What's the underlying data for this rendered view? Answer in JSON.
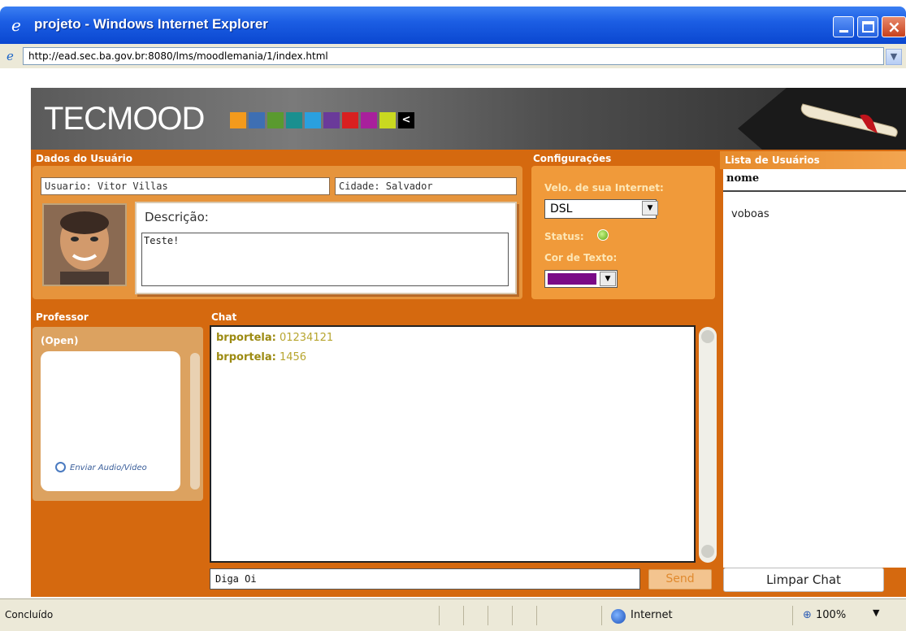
{
  "window": {
    "title": "projeto - Windows Internet Explorer",
    "url": "http://ead.sec.ba.gov.br:8080/lms/moodlemania/1/index.html"
  },
  "app": {
    "logo": "TECMOOD",
    "swatch_colors": [
      "#f39a1c",
      "#3e6fb3",
      "#5a9a2f",
      "#1a8f8f",
      "#2aa0df",
      "#6a3a9a",
      "#d82020",
      "#a8209c",
      "#c9d820"
    ],
    "logo_arrow": "<"
  },
  "user": {
    "section_label": "Dados do Usuário",
    "usuario": "Usuario: Vitor Villas",
    "cidade": "Cidade: Salvador",
    "descricao_label": "Descrição:",
    "descricao_value": "Teste!"
  },
  "config": {
    "section_label": "Configurações",
    "speed_label": "Velo. de sua Internet:",
    "speed_value": "DSL",
    "status_label": "Status:",
    "status_color": "#5aa30c",
    "text_color_label": "Cor de Texto:",
    "text_color_value": "#7a0a86"
  },
  "users": {
    "section_label": "Lista de Usuários",
    "column_header": "nome",
    "items": [
      "voboas"
    ],
    "clear_button": "Limpar Chat"
  },
  "professor": {
    "section_label": "Professor",
    "status": "(Open)",
    "send_av": "Enviar Audio/Video"
  },
  "chat": {
    "section_label": "Chat",
    "messages": [
      {
        "user": "brportela:",
        "text": "01234121"
      },
      {
        "user": "brportela:",
        "text": "1456"
      }
    ],
    "input_value": "Diga Oi",
    "send_button": "Send"
  },
  "statusbar": {
    "status": "Concluído",
    "zone": "Internet",
    "zoom": "100%"
  }
}
